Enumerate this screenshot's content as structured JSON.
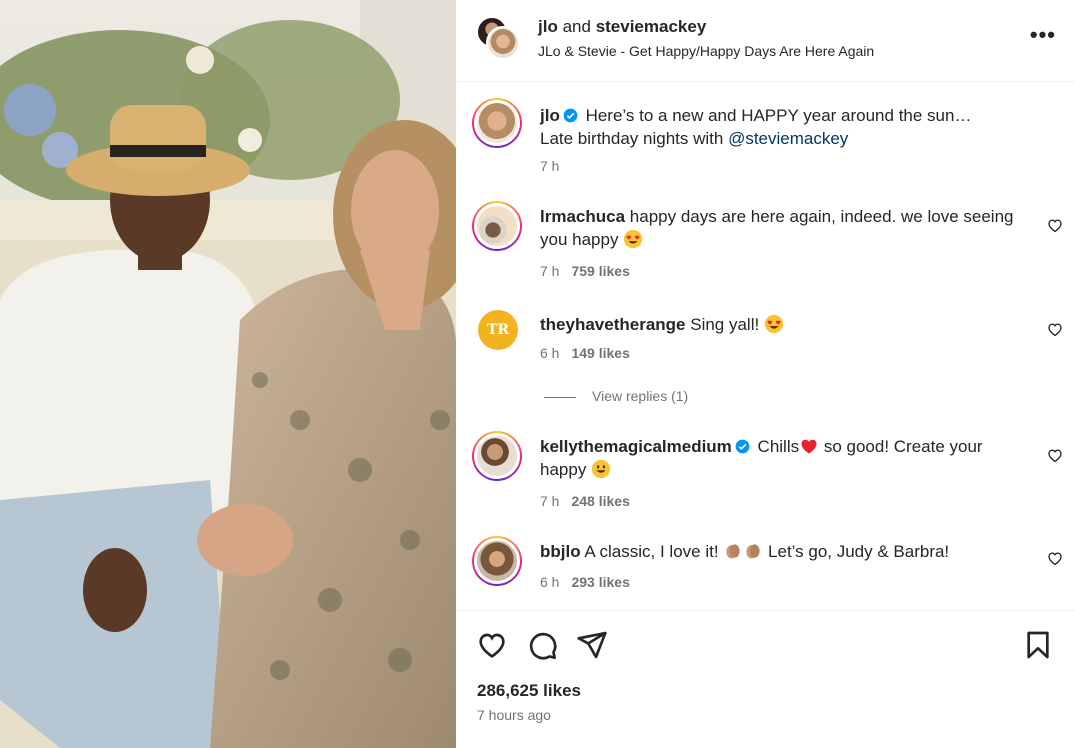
{
  "header": {
    "user1": "jlo",
    "joiner": "and",
    "user2": "steviemackey",
    "subtitle": "JLo & Stevie - Get Happy/Happy Days Are Here Again",
    "more_icon": "more-horizontal-icon"
  },
  "caption": {
    "user": "jlo",
    "text1": "Here’s to a new and HAPPY year around the sun…",
    "text2": "Late birthday nights with ",
    "mention": "@steviemackey",
    "time": "7 h"
  },
  "comments": [
    {
      "user": "lrmachuca",
      "text": "happy days are here again, indeed. we love seeing you happy",
      "emoji": "heart-eyes-emoji",
      "time": "7 h",
      "likes": "759 likes"
    },
    {
      "user": "theyhavetherange",
      "text": "Sing yall!",
      "emoji": "heart-eyes-emoji",
      "time": "6 h",
      "likes": "149 likes",
      "avatar_text": "TR"
    },
    {
      "user": "kellythemagicalmedium",
      "text_a": "Chills",
      "text_b": " so good! Create your happy",
      "emoji": "smile-emoji",
      "time": "7 h",
      "likes": "248 likes"
    },
    {
      "user": "bbjlo",
      "text_a": "A classic, I love it!",
      "text_b": " Let’s go, Judy & Barbra!",
      "emoji": "clap-emoji",
      "time": "6 h",
      "likes": "293 likes"
    }
  ],
  "view_replies": "View replies (1)",
  "footer": {
    "likes": "286,625 likes",
    "time_ago": "7 hours ago"
  },
  "colors": {
    "text": "#262626",
    "secondary": "#737373",
    "verified": "#0095f6",
    "mention": "#00376b"
  }
}
